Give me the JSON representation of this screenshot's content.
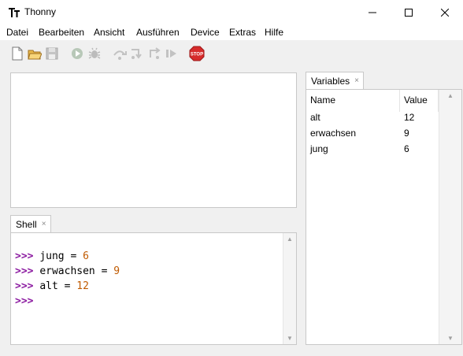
{
  "window": {
    "title": "Thonny",
    "icon": "thonny-logo-icon"
  },
  "menu": [
    "Datei",
    "Bearbeiten",
    "Ansicht",
    "Ausführen",
    "Device",
    "Extras",
    "Hilfe"
  ],
  "toolbar": {
    "icons": [
      "new-file-icon",
      "open-file-icon",
      "save-icon",
      "run-icon",
      "debug-icon",
      "step-over-icon",
      "step-into-icon",
      "step-out-icon",
      "resume-icon",
      "stop-icon"
    ],
    "stop_label": "STOP"
  },
  "tabs": {
    "shell": "Shell",
    "variables": "Variables",
    "close": "×"
  },
  "shell": {
    "prompt": ">>>",
    "lines": [
      {
        "code": "jung = ",
        "value": "6"
      },
      {
        "code": "erwachsen = ",
        "value": "9"
      },
      {
        "code": "alt = ",
        "value": "12"
      }
    ]
  },
  "variables": {
    "columns": [
      "Name",
      "Value"
    ],
    "rows": [
      {
        "name": "alt",
        "value": "12"
      },
      {
        "name": "erwachsen",
        "value": "9"
      },
      {
        "name": "jung",
        "value": "6"
      }
    ]
  },
  "colors": {
    "prompt": "#8b1aa0",
    "number": "#c05a00",
    "stop": "#d62b2b"
  }
}
